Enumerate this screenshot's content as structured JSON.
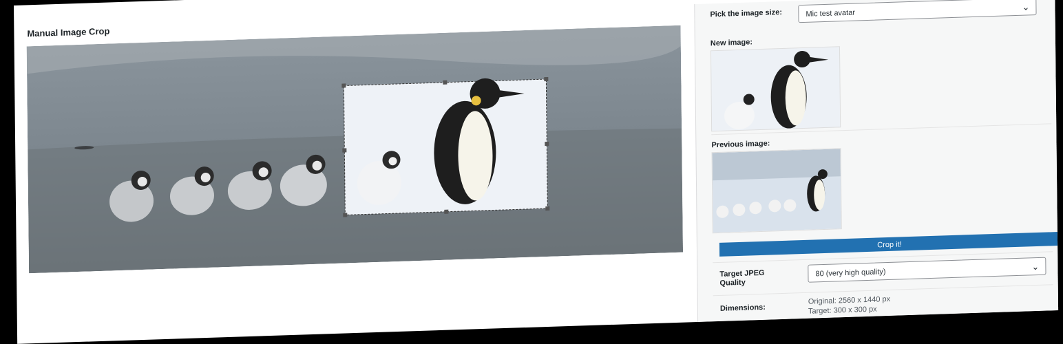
{
  "modal": {
    "title": "Manual Image Crop",
    "close_icon": "close-icon"
  },
  "sidebar": {
    "size_label": "Pick the image size:",
    "size_value": "Mic test avatar",
    "new_image_label": "New image:",
    "previous_image_label": "Previous image:",
    "crop_button": "Crop it!",
    "quality_label": "Target JPEG Quality",
    "quality_value": "80 (very high quality)",
    "dimensions_label": "Dimensions:",
    "dimensions_original": "Original: 2560 x 1440 px",
    "dimensions_target": "Target: 300 x 300 px"
  },
  "colors": {
    "accent": "#2271b1"
  }
}
